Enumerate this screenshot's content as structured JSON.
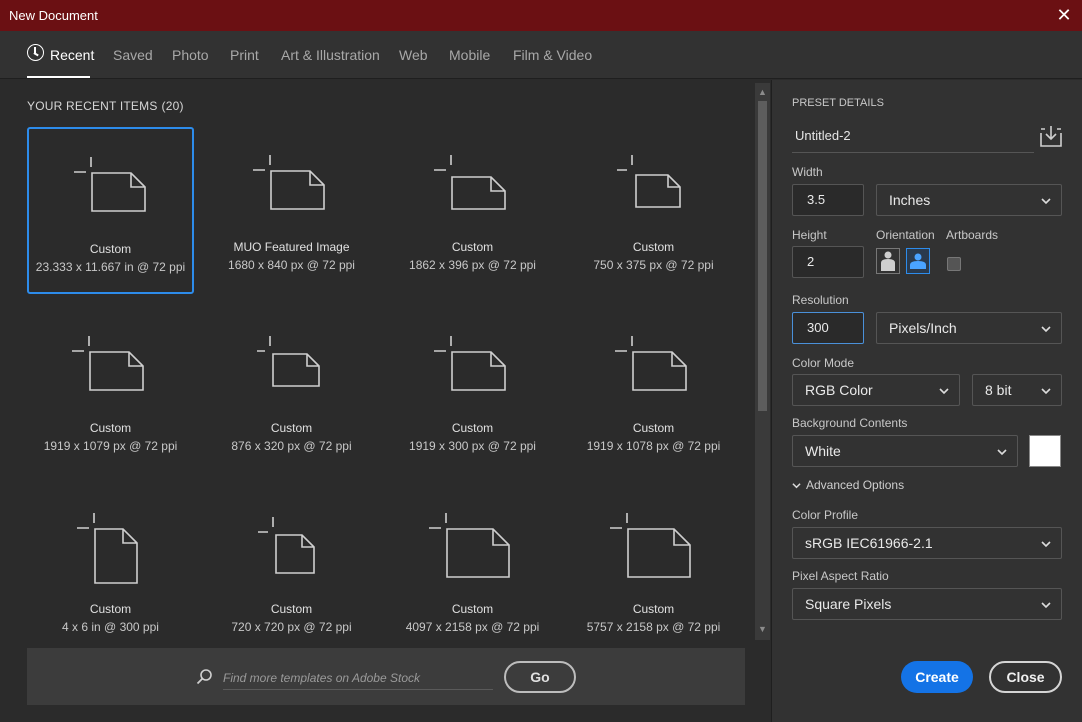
{
  "window": {
    "title": "New Document"
  },
  "tabs": [
    {
      "label": "Recent"
    },
    {
      "label": "Saved"
    },
    {
      "label": "Photo"
    },
    {
      "label": "Print"
    },
    {
      "label": "Art & Illustration"
    },
    {
      "label": "Web"
    },
    {
      "label": "Mobile"
    },
    {
      "label": "Film & Video"
    }
  ],
  "recent": {
    "title": "YOUR RECENT ITEMS",
    "count": "(20)",
    "items": [
      {
        "name": "Custom",
        "size": "23.333 x 11.667 in @ 72 ppi"
      },
      {
        "name": "MUO Featured Image",
        "size": "1680 x 840 px @ 72 ppi"
      },
      {
        "name": "Custom",
        "size": "1862 x 396 px @ 72 ppi"
      },
      {
        "name": "Custom",
        "size": "750 x 375 px @ 72 ppi"
      },
      {
        "name": "Custom",
        "size": "1919 x 1079 px @ 72 ppi"
      },
      {
        "name": "Custom",
        "size": "876 x 320 px @ 72 ppi"
      },
      {
        "name": "Custom",
        "size": "1919 x 300 px @ 72 ppi"
      },
      {
        "name": "Custom",
        "size": "1919 x 1078 px @ 72 ppi"
      },
      {
        "name": "Custom",
        "size": "4 x 6 in @ 300 ppi"
      },
      {
        "name": "Custom",
        "size": "720 x 720 px @ 72 ppi"
      },
      {
        "name": "Custom",
        "size": "4097 x 2158 px @ 72 ppi"
      },
      {
        "name": "Custom",
        "size": "5757 x 2158 px @ 72 ppi"
      }
    ]
  },
  "search": {
    "placeholder": "Find more templates on Adobe Stock",
    "go_label": "Go"
  },
  "preset": {
    "heading": "PRESET DETAILS",
    "name": "Untitled-2",
    "width_label": "Width",
    "width_value": "3.5",
    "width_unit": "Inches",
    "height_label": "Height",
    "height_value": "2",
    "orientation_label": "Orientation",
    "artboards_label": "Artboards",
    "resolution_label": "Resolution",
    "resolution_value": "300",
    "resolution_unit": "Pixels/Inch",
    "color_mode_label": "Color Mode",
    "color_mode": "RGB Color",
    "bit_depth": "8 bit",
    "background_label": "Background Contents",
    "background": "White",
    "advanced_label": "Advanced Options",
    "color_profile_label": "Color Profile",
    "color_profile": "sRGB IEC61966-2.1",
    "pixel_aspect_label": "Pixel Aspect Ratio",
    "pixel_aspect": "Square Pixels",
    "create_label": "Create",
    "close_label": "Close"
  },
  "colors": {
    "titlebar": "#6b1013",
    "accent": "#2d8ceb",
    "create": "#1473e6"
  }
}
